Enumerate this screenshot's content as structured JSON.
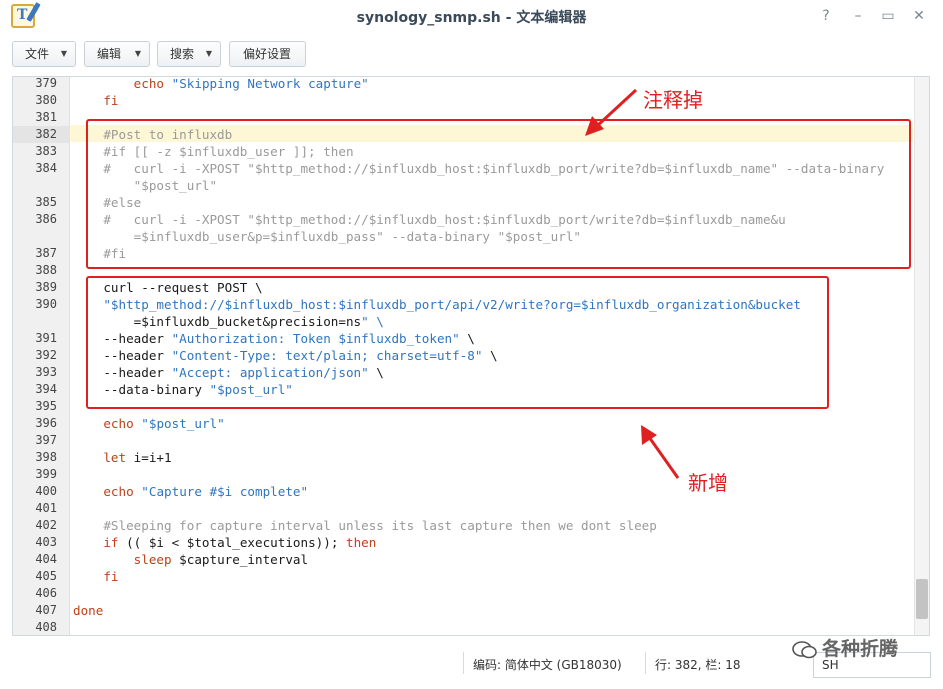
{
  "window": {
    "title": "synology_snmp.sh - 文本编辑器",
    "controls": [
      "?",
      "–",
      "▭",
      "✕"
    ]
  },
  "toolbar": {
    "file_label": "文件",
    "edit_label": "编辑",
    "search_label": "搜索",
    "prefs_label": "偏好设置"
  },
  "editor": {
    "active_line": "382",
    "lines": [
      {
        "n": "379",
        "text": "        echo \"Skipping Network capture\""
      },
      {
        "n": "380",
        "text": "    fi"
      },
      {
        "n": "381",
        "text": ""
      },
      {
        "n": "382",
        "text": "    #Post to influxdb"
      },
      {
        "n": "383",
        "text": "    #if [[ -z $influxdb_user ]]; then"
      },
      {
        "n": "384",
        "text": "    #   curl -i -XPOST \"$http_method://$influxdb_host:$influxdb_port/write?db=$influxdb_name\" --data-binary"
      },
      {
        "n": "",
        "text": "        \"$post_url\""
      },
      {
        "n": "385",
        "text": "    #else"
      },
      {
        "n": "386",
        "text": "    #   curl -i -XPOST \"$http_method://$influxdb_host:$influxdb_port/write?db=$influxdb_name&u"
      },
      {
        "n": "",
        "text": "        =$influxdb_user&p=$influxdb_pass\" --data-binary \"$post_url\""
      },
      {
        "n": "387",
        "text": "    #fi"
      },
      {
        "n": "388",
        "text": ""
      },
      {
        "n": "389",
        "text": "    curl --request POST \\"
      },
      {
        "n": "390",
        "text": "    \"$http_method://$influxdb_host:$influxdb_port/api/v2/write?org=$influxdb_organization&bucket"
      },
      {
        "n": "",
        "text": "        =$influxdb_bucket&precision=ns\" \\"
      },
      {
        "n": "391",
        "text": "    --header \"Authorization: Token $influxdb_token\" \\"
      },
      {
        "n": "392",
        "text": "    --header \"Content-Type: text/plain; charset=utf-8\" \\"
      },
      {
        "n": "393",
        "text": "    --header \"Accept: application/json\" \\"
      },
      {
        "n": "394",
        "text": "    --data-binary \"$post_url\""
      },
      {
        "n": "395",
        "text": ""
      },
      {
        "n": "396",
        "text": "    echo \"$post_url\""
      },
      {
        "n": "397",
        "text": ""
      },
      {
        "n": "398",
        "text": "    let i=i+1"
      },
      {
        "n": "399",
        "text": ""
      },
      {
        "n": "400",
        "text": "    echo \"Capture #$i complete\""
      },
      {
        "n": "401",
        "text": ""
      },
      {
        "n": "402",
        "text": "    #Sleeping for capture interval unless its last capture then we dont sleep"
      },
      {
        "n": "403",
        "text": "    if (( $i < $total_executions)); then"
      },
      {
        "n": "404",
        "text": "        sleep $capture_interval"
      },
      {
        "n": "405",
        "text": "    fi"
      },
      {
        "n": "406",
        "text": ""
      },
      {
        "n": "407",
        "text": "done"
      },
      {
        "n": "408",
        "text": ""
      }
    ]
  },
  "annotations": {
    "commented": "注释掉",
    "added": "新增"
  },
  "statusbar": {
    "encoding": "编码: 简体中文 (GB18030)",
    "position": "行: 382, 栏: 18",
    "language": "SH"
  },
  "watermark": "各种折腾",
  "colors": {
    "annotation": "#e02020",
    "comment": "#9a9a9a",
    "string": "#2f75c0",
    "active_line": "#fdf7d5"
  }
}
